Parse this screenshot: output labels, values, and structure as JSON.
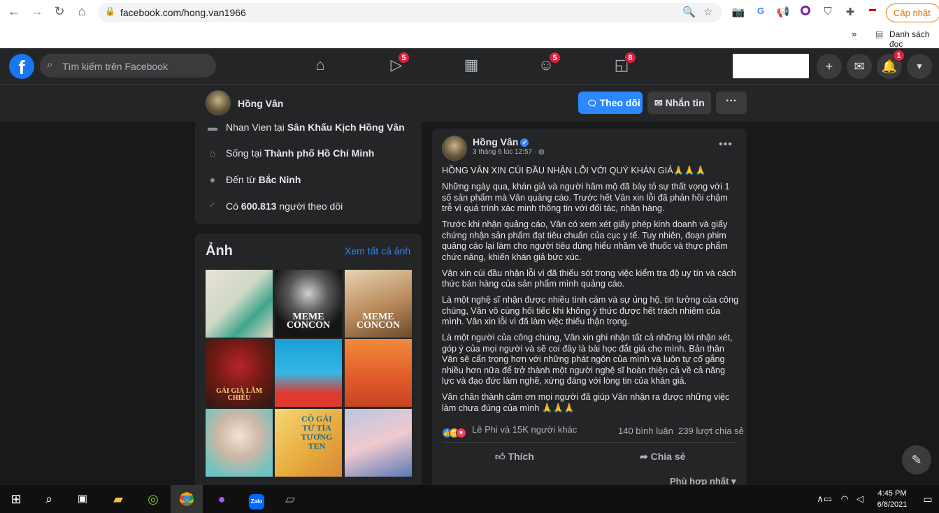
{
  "browser": {
    "url": "facebook.com/hong.van1966",
    "update_label": "Cập nhật",
    "bookmark_overflow": "»",
    "bookmark_item": "Danh sách đọc"
  },
  "fb_header": {
    "logo": "f",
    "search_placeholder": "Tìm kiếm trên Facebook",
    "badges": {
      "watch": "5",
      "groups": "5",
      "gaming": "8",
      "notifications": "1"
    }
  },
  "profile": {
    "name": "Hồng Vân",
    "follow_label": "Theo dõi",
    "message_label": "Nhắn tin",
    "more_label": "···"
  },
  "intro": {
    "work_prefix": "Nhan Vien tại ",
    "work_place": "Sân Khấu Kịch Hồng Vân",
    "lives_prefix": "Sống tại ",
    "lives_place": "Thành phố Hồ Chí Minh",
    "from_prefix": "Đến từ ",
    "from_place": "Bắc Ninh",
    "followers_prefix": "Có ",
    "followers_count": "600.813",
    "followers_suffix": " người theo dõi"
  },
  "photos": {
    "title": "Ảnh",
    "see_all": "Xem tất cả ảnh",
    "captions": [
      "",
      "MEME CONCON",
      "MEME CONCON",
      "GÁI GIÀ LẮM CHIÊU",
      "",
      "",
      "",
      "CÔ GÁI TỪ TÍA TƯƠNG TEN",
      ""
    ]
  },
  "post": {
    "author": "Hồng Vân",
    "timestamp": "3 tháng 6 lúc 12:57 · ",
    "more": "•••",
    "paragraphs": [
      "HỒNG VÂN XIN CÚI ĐẦU NHẬN LỖI VỚI QUÝ KHÁN GIẢ🙏🙏🙏",
      "Những ngày qua, khán giả và người hâm mộ đã bày tỏ sự thất vọng với 1 số sản phẩm mà Vân quảng cáo. Trước hết Vân xin lỗi đã phản hồi chậm trễ vì quá trình xác minh thông tin với đối tác, nhãn hàng.",
      "Trước khi nhận quảng cáo, Vân có xem xét giấy phép kinh doanh và giấy chứng nhận sản phẩm đạt tiêu chuẩn của cục y tế. Tuy nhiên, đoạn phim quảng cáo lại làm cho người tiêu dùng hiểu nhầm về thuốc và thực phẩm chức năng, khiến khán giả bức xúc.",
      "Vân xin cúi đầu nhận lỗi vì đã thiếu sót trong việc kiểm tra độ uy tín và cách thức bán hàng của sản phẩm mình quảng cáo.",
      "Là một nghệ sĩ nhận được nhiều tình cảm và sự ủng hộ, tin tưởng của công chúng, Vân vô cùng hối tiếc khi không ý thức được hết trách nhiệm của mình. Vân xin lỗi vì đã làm việc thiếu thận trọng.",
      " Là một người của công chúng, Vân xin ghi nhận tất cả những lời nhận xét, góp ý của mọi người và sẽ coi đây là bài học đắt giá cho mình. Bản thân Vân sẽ cẩn trọng hơn với những phát ngôn của mình và luôn tự cố gắng nhiều hơn nữa để trở thành một người nghệ sĩ hoàn thiện cả về cả năng lực và đạo đức làm nghề, xứng đáng với lòng tin của khán giả.",
      "Vân chân thành cảm ơn mọi người đã giúp Vân nhận ra được những việc làm chưa đúng của mình 🙏🙏🙏"
    ],
    "reactions_text": "Lê Phi và 15K người khác",
    "comments": "140 bình luận",
    "shares": "239 lượt chia sẻ",
    "like_label": "Thích",
    "share_label": "Chia sẻ",
    "sort_label": "Phù hợp nhất"
  },
  "taskbar": {
    "time": "4:45 PM",
    "date": "6/8/2021"
  },
  "colors": {
    "fb_blue": "#2d88ff",
    "badge_red": "#e41e3f",
    "bg": "#18191a",
    "card": "#242526"
  }
}
